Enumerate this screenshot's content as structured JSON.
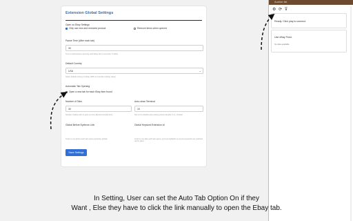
{
  "settings": {
    "title": "Extension Global Settings",
    "open_on_ebay_settings": "Open on Ebay Settings",
    "check1_label": "Only use new and renewed product",
    "check1_checked": true,
    "check2_label": "Remove items when opened",
    "check2_checked": false,
    "pause_label": "Pause Time (After each tab)",
    "pause_value": "30",
    "pause_hint": "Time to wait between opening each Ebay tab (in seconds, 5-120s)",
    "country_label": "Default Country",
    "country_value": "USA",
    "country_hint": "Select default country for Ebay (Will not override existing value)",
    "auto_tab_label": "Automatic Tab Opening",
    "auto_tab_check_label": "Open a new tab for each Ebay item found",
    "auto_tab_checked": false,
    "tabs_label": "Number of Tabs",
    "tabs_value": "30",
    "tabs_hint": "Number of Ebay tabs to open at once (Recommended limit)",
    "terminal_label": "Auto-close Terminal",
    "terminal_value": "15",
    "terminal_hint": "Set to 0 to disable auto-closing (Close tab after X s) - Default",
    "before_label": "Global Before Eyebrow Link",
    "before_hint": "Script to run before each tab opens (optional, global)",
    "after_label": "Global Keyword Extension Id",
    "after_hint": "Script to run after each tab opens, such as highlights to ensure keywords are matched and in place",
    "save_label": "Save Settings"
  },
  "sidebar": {
    "header": "Auction list",
    "icons": "⚙ ⟳ ⊽",
    "status": "Ready. Click play to connect.",
    "panel_title": "Use eBay Feed.",
    "panel_sub": "No data available"
  },
  "caption": {
    "line1": "In Setting, User can set the Auto Tab Option On  if they",
    "line2": "Want , Else they have to click the link manually to open the Ebay tab."
  }
}
